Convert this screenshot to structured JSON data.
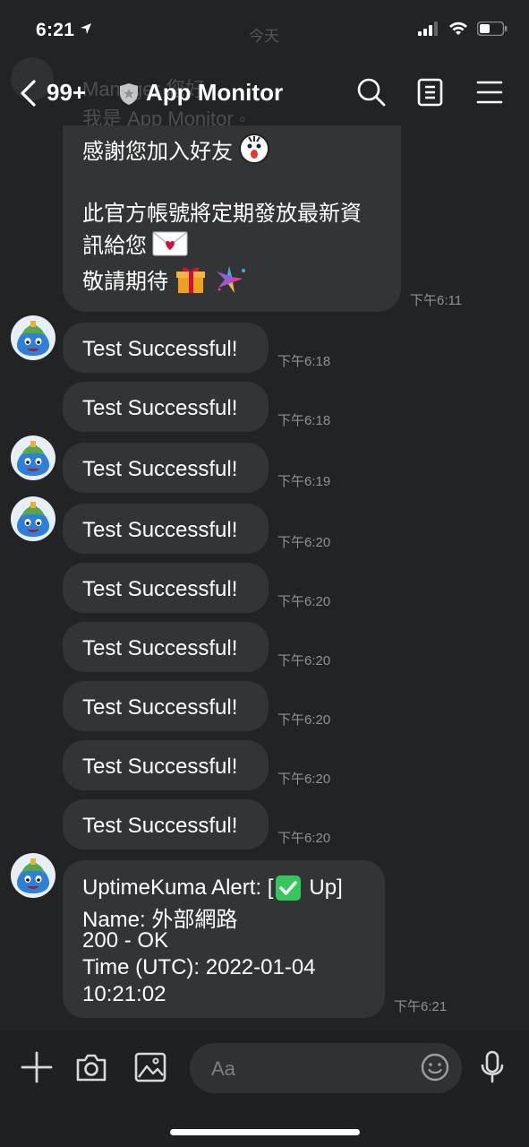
{
  "status_bar": {
    "time": "6:21",
    "center_label": "今天"
  },
  "header": {
    "ghost_name": "Manager 您好",
    "ghost_subtitle": "我是 App Monitor ◦",
    "unread_count": "99+",
    "title": "App Monitor"
  },
  "welcome": {
    "line1": "感謝您加入好友",
    "line2": "此官方帳號將定期發放最新資",
    "line3": "訊給您",
    "line4": "敬請期待",
    "time": "下午6:11"
  },
  "messages": [
    {
      "text": "Test Successful!",
      "time": "下午6:18"
    },
    {
      "text": "Test Successful!",
      "time": "下午6:18"
    },
    {
      "text": "Test Successful!",
      "time": "下午6:19"
    },
    {
      "text": "Test Successful!",
      "time": "下午6:20"
    },
    {
      "text": "Test Successful!",
      "time": "下午6:20"
    },
    {
      "text": "Test Successful!",
      "time": "下午6:20"
    },
    {
      "text": "Test Successful!",
      "time": "下午6:20"
    },
    {
      "text": "Test Successful!",
      "time": "下午6:20"
    },
    {
      "text": "Test Successful!",
      "time": "下午6:20"
    }
  ],
  "alert": {
    "line1_prefix": "UptimeKuma Alert: [",
    "line1_status": "Up]",
    "line2": "Name: 外部網路",
    "line3": "200 - OK",
    "line4": "Time (UTC): 2022-01-04",
    "line5": "10:21:02",
    "time": "下午6:21"
  },
  "input": {
    "placeholder": "Aa"
  },
  "icons": [
    "back-arrow-icon",
    "shield-icon",
    "search-icon",
    "notes-icon",
    "menu-icon",
    "plus-icon",
    "camera-icon",
    "image-icon",
    "emoji-icon",
    "microphone-icon",
    "slime-avatar-icon"
  ],
  "colors": {
    "background": "#222324",
    "bubble": "#333436",
    "timestamp": "#8f9194",
    "check_green": "#35c759"
  }
}
